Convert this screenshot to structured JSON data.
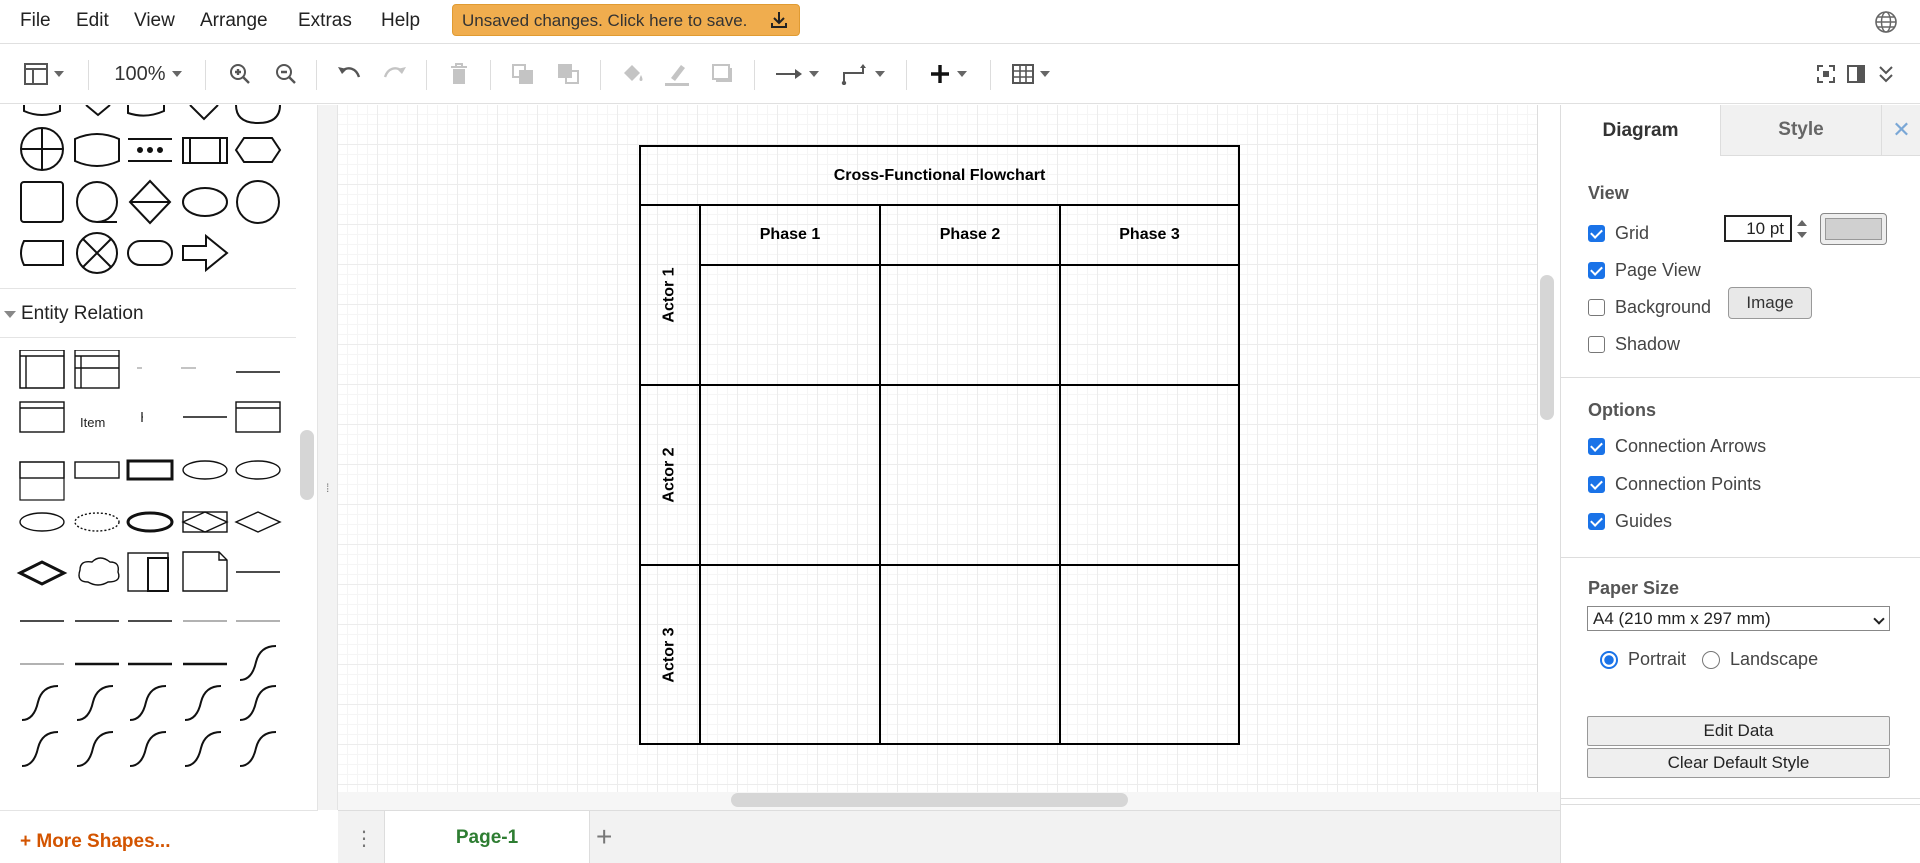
{
  "menubar": {
    "items": [
      "File",
      "Edit",
      "View",
      "Arrange",
      "Extras",
      "Help"
    ],
    "unsaved_banner": "Unsaved changes. Click here to save."
  },
  "toolbar": {
    "zoom": "100%"
  },
  "sidebar": {
    "entity_relation_header": "Entity Relation",
    "item_label": "Item",
    "more_shapes": "More Shapes..."
  },
  "diagram": {
    "title": "Cross-Functional Flowchart",
    "phases": [
      "Phase 1",
      "Phase 2",
      "Phase 3"
    ],
    "actors": [
      "Actor 1",
      "Actor 2",
      "Actor 3"
    ]
  },
  "pages": {
    "current": "Page-1"
  },
  "panel": {
    "tabs": {
      "diagram": "Diagram",
      "style": "Style"
    },
    "view": {
      "title": "View",
      "grid": {
        "label": "Grid",
        "checked": true,
        "size": "10 pt",
        "color": "#d0d0d0"
      },
      "page_view": {
        "label": "Page View",
        "checked": true
      },
      "background": {
        "label": "Background",
        "checked": false,
        "button": "Image"
      },
      "shadow": {
        "label": "Shadow",
        "checked": false
      }
    },
    "options": {
      "title": "Options",
      "items": [
        {
          "label": "Connection Arrows",
          "checked": true
        },
        {
          "label": "Connection Points",
          "checked": true
        },
        {
          "label": "Guides",
          "checked": true
        }
      ]
    },
    "paper": {
      "title": "Paper Size",
      "selected": "A4 (210 mm x 297 mm)",
      "portrait": "Portrait",
      "landscape": "Landscape",
      "orientation": "portrait"
    },
    "buttons": {
      "edit_data": "Edit Data",
      "clear_style": "Clear Default Style"
    }
  },
  "colors": {
    "unsaved_bg": "#f0ad4e",
    "accent": "#1a73e8",
    "page_tab": "#2e7d32",
    "more_shapes": "#d35400"
  }
}
